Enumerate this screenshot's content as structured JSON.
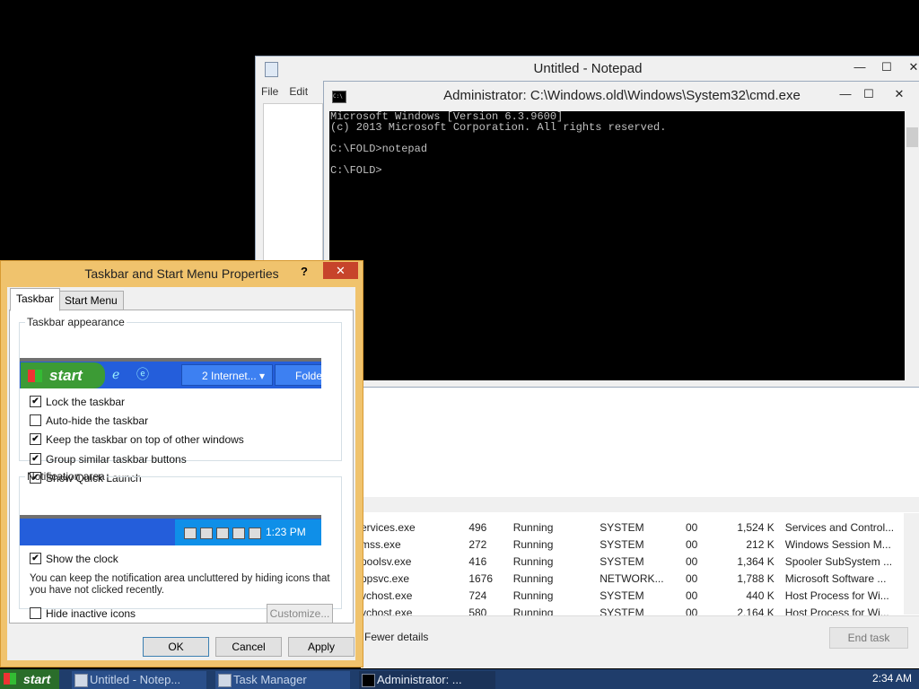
{
  "notepad": {
    "title": "Untitled - Notepad",
    "menu": [
      "File",
      "Edit"
    ],
    "controls": {
      "minimize": "—",
      "maximize": "☐",
      "close": "✕"
    }
  },
  "cmd": {
    "title": "Administrator: C:\\Windows.old\\Windows\\System32\\cmd.exe",
    "icon_text": "C:\\",
    "lines": [
      "Microsoft Windows [Version 6.3.9600]",
      "(c) 2013 Microsoft Corporation. All rights reserved.",
      "",
      "C:\\FOLD>notepad",
      "",
      "C:\\FOLD>"
    ],
    "controls": {
      "minimize": "—",
      "maximize": "☐",
      "close": "✕"
    }
  },
  "taskmgr": {
    "rows": [
      [
        "ervices.exe",
        "496",
        "Running",
        "SYSTEM",
        "00",
        "1,524 K",
        "Services and Control..."
      ],
      [
        "mss.exe",
        "272",
        "Running",
        "SYSTEM",
        "00",
        "212 K",
        "Windows Session M..."
      ],
      [
        "poolsv.exe",
        "416",
        "Running",
        "SYSTEM",
        "00",
        "1,364 K",
        "Spooler SubSystem ..."
      ],
      [
        "ppsvc.exe",
        "1676",
        "Running",
        "NETWORK...",
        "00",
        "1,788 K",
        "Microsoft Software ..."
      ],
      [
        "vchost.exe",
        "724",
        "Running",
        "SYSTEM",
        "00",
        "440 K",
        "Host Process for Wi..."
      ],
      [
        "vchost.exe",
        "580",
        "Running",
        "SYSTEM",
        "00",
        "2,164 K",
        "Host Process for Wi..."
      ]
    ],
    "fewer_details": "Fewer details",
    "end_task": "End task"
  },
  "dialog": {
    "title": "Taskbar and Start Menu Properties",
    "help": "?",
    "close": "✕",
    "tabs": [
      "Taskbar",
      "Start Menu"
    ],
    "appearance": {
      "legend": "Taskbar appearance",
      "preview": {
        "start": "start",
        "task1": "2 Internet...",
        "task2": "Folde"
      },
      "options": [
        {
          "label": "Lock the taskbar",
          "checked": "✔"
        },
        {
          "label": "Auto-hide the taskbar",
          "checked": ""
        },
        {
          "label": "Keep the taskbar on top of other windows",
          "checked": "✔"
        },
        {
          "label": "Group similar taskbar buttons",
          "checked": "✔"
        },
        {
          "label": "Show Quick Launch",
          "checked": "✔"
        }
      ]
    },
    "notification": {
      "legend": "Notification area",
      "clock": "1:23 PM",
      "show_clock": {
        "label": "Show the clock",
        "checked": "✔"
      },
      "description": "You can keep the notification area uncluttered by hiding icons that you have not clicked recently.",
      "hide_inactive": {
        "label": "Hide inactive icons",
        "checked": ""
      },
      "customize": "Customize..."
    },
    "buttons": {
      "ok": "OK",
      "cancel": "Cancel",
      "apply": "Apply"
    }
  },
  "taskbar": {
    "start": "start",
    "buttons": [
      "Untitled - Notep...",
      "Task Manager",
      "Administrator: ..."
    ],
    "clock": "2:34 AM"
  }
}
